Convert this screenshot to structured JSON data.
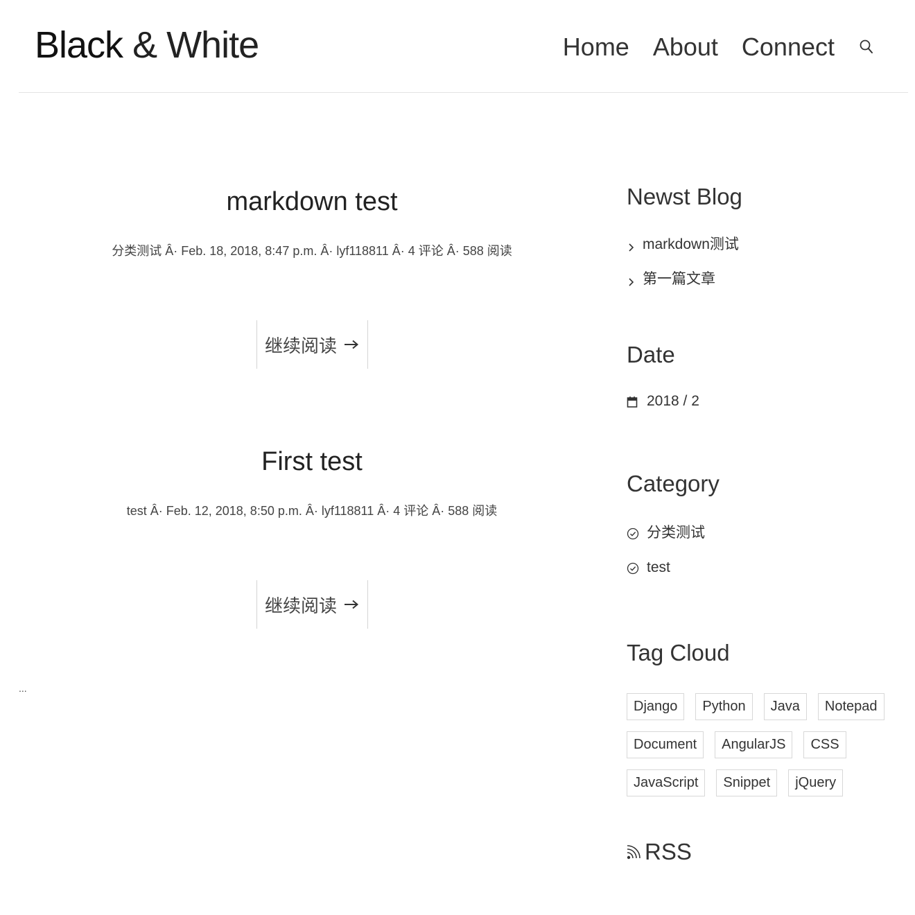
{
  "site": {
    "logo_bold": "Black",
    "logo_rest": "& White"
  },
  "nav": {
    "items": [
      {
        "label": "Home"
      },
      {
        "label": "About"
      },
      {
        "label": "Connect"
      }
    ],
    "search_icon": "search-icon"
  },
  "posts": [
    {
      "title": "markdown test",
      "meta": "分类测试 Â· Feb. 18, 2018, 8:47 p.m. Â· lyf118811 Â· 4 评论 Â· 588 阅读",
      "read_more": "继续阅读"
    },
    {
      "title": "First test",
      "meta": "test Â· Feb. 12, 2018, 8:50 p.m. Â· lyf118811 Â· 4 评论 Â· 588 阅读",
      "read_more": "继续阅读"
    }
  ],
  "pagination_text": "...",
  "sidebar": {
    "newest": {
      "title": "Newst Blog",
      "items": [
        "markdown测试",
        "第一篇文章"
      ]
    },
    "date": {
      "title": "Date",
      "items": [
        "2018 / 2"
      ]
    },
    "category": {
      "title": "Category",
      "items": [
        "分类测试",
        "test"
      ]
    },
    "tags": {
      "title": "Tag Cloud",
      "items": [
        "Django",
        "Python",
        "Java",
        "Notepad",
        "Document",
        "AngularJS",
        "CSS",
        "JavaScript",
        "Snippet",
        "jQuery"
      ]
    },
    "rss": {
      "label": "RSS"
    }
  }
}
